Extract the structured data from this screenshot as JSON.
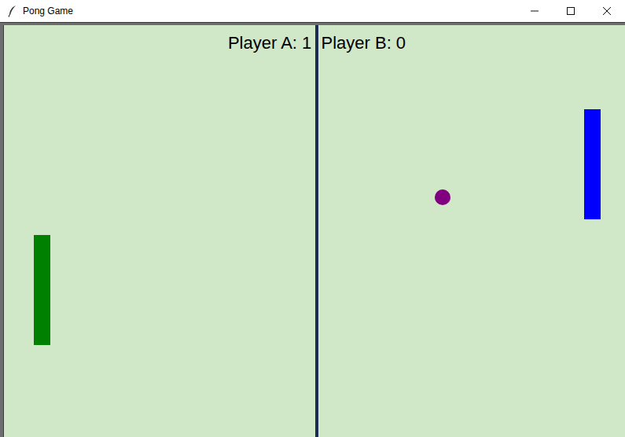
{
  "window": {
    "title": "Pong Game"
  },
  "scoreboard": "Player A: 1  Player B: 0",
  "paddles": [
    {
      "color": "#008000"
    },
    {
      "color": "#0000ff"
    }
  ]
}
